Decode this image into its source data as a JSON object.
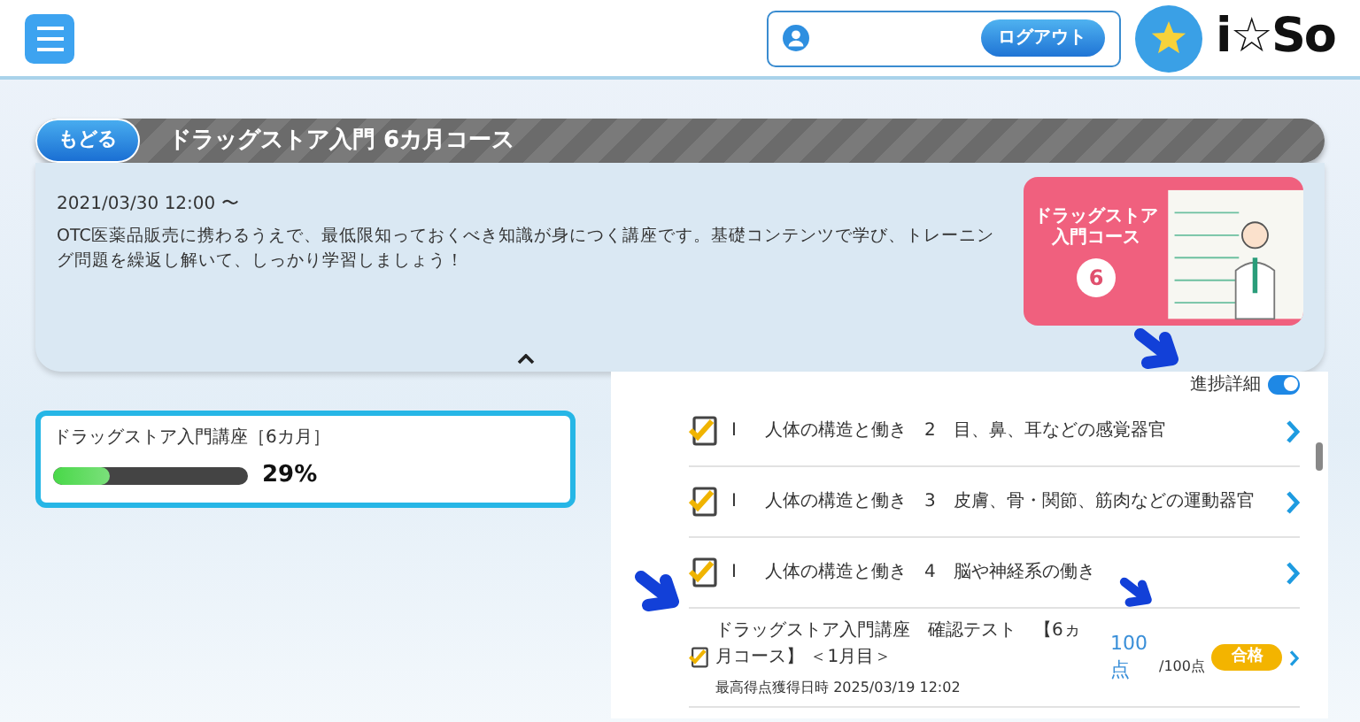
{
  "header": {
    "user_field": {
      "logout_button": "ログアウト"
    },
    "logo_text": "i☆So"
  },
  "course": {
    "back_button": "もどる",
    "title": "ドラッグストア入門 6カ月コース",
    "date": "2021/03/30 12:00 〜",
    "description": "OTC医薬品販売に携わるうえで、最低限知っておくべき知識が身につく講座です。基礎コンテンツで学び、トレーニング問題を繰返し解いて、しっかり学習しましょう！",
    "thumbnail": {
      "title": "ドラッグストア入門コース",
      "number": "6"
    }
  },
  "progress": {
    "title": "ドラッグストア入門講座［6カ月］",
    "level": 0.29,
    "percent": "29%"
  },
  "detail_toggle": {
    "label": "進捗詳細",
    "on": true
  },
  "lessons": [
    {
      "kind": "lesson",
      "mark": "I",
      "title": "人体の構造と働き　2　目、鼻、耳などの感覚器官",
      "completed": true
    },
    {
      "kind": "lesson",
      "mark": "I",
      "title": "人体の構造と働き　3　皮膚、骨・関節、筋肉などの運動器官",
      "completed": true
    },
    {
      "kind": "lesson",
      "mark": "I",
      "title": "人体の構造と働き　4　脳や神経系の働き",
      "completed": true
    },
    {
      "kind": "test",
      "title": "ドラッグストア入門講座　確認テスト　【6ヵ月コース】 ＜1月目＞",
      "date_label": "最高得点獲得日時 2025/03/19 12:02",
      "score": "100点",
      "total": "/100点",
      "badge": "合格",
      "completed": true
    }
  ]
}
